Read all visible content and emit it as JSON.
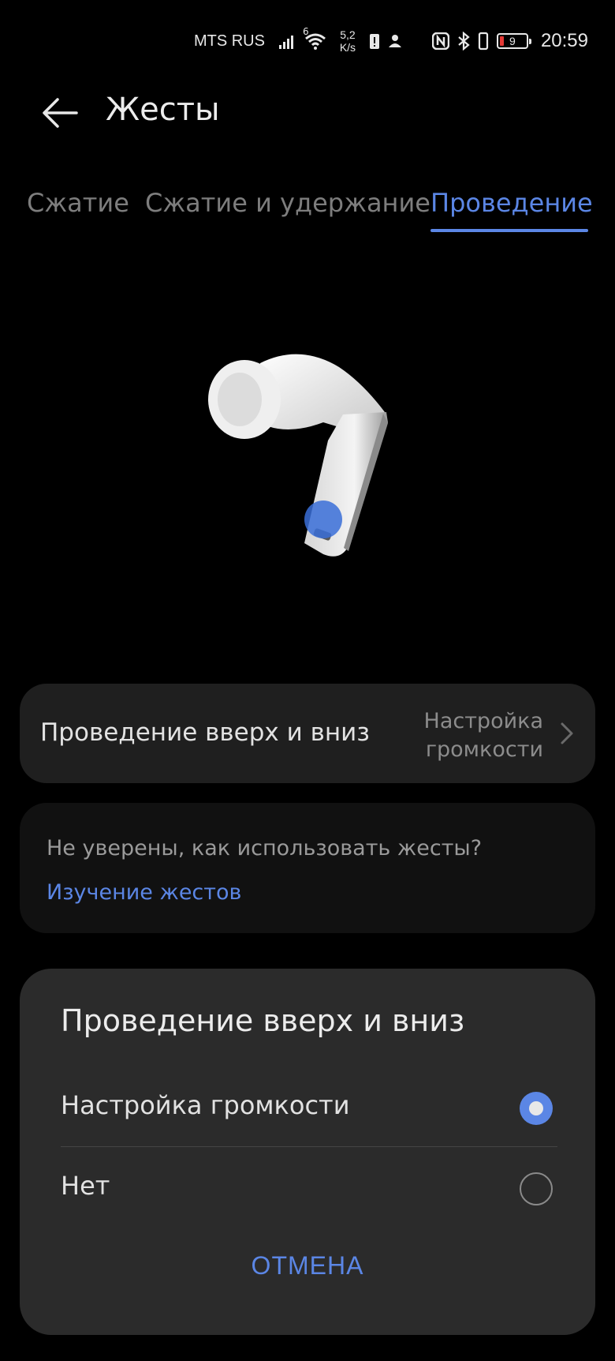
{
  "status_bar": {
    "carrier": "MTS RUS",
    "network_type": "6",
    "speed_value": "5,2",
    "speed_unit": "K/s",
    "battery_level": "9",
    "time": "20:59"
  },
  "header": {
    "title": "Жесты"
  },
  "tabs": [
    {
      "label": "Сжатие",
      "active": false
    },
    {
      "label": "Сжатие и удержание",
      "active": false
    },
    {
      "label": "Проведение",
      "active": true
    }
  ],
  "gesture_row": {
    "label": "Проведение вверх и вниз",
    "value_line1": "Настройка",
    "value_line2": "громкости"
  },
  "help": {
    "text": "Не уверены, как использовать жесты?",
    "link": "Изучение жестов"
  },
  "dialog": {
    "title": "Проведение вверх и вниз",
    "options": [
      {
        "label": "Настройка громкости",
        "selected": true
      },
      {
        "label": "Нет",
        "selected": false
      }
    ],
    "cancel_label": "ОТМЕНА"
  },
  "colors": {
    "accent": "#5b86e5",
    "background": "#000000",
    "card": "#1f1f1f",
    "dialog": "#2b2b2b"
  }
}
